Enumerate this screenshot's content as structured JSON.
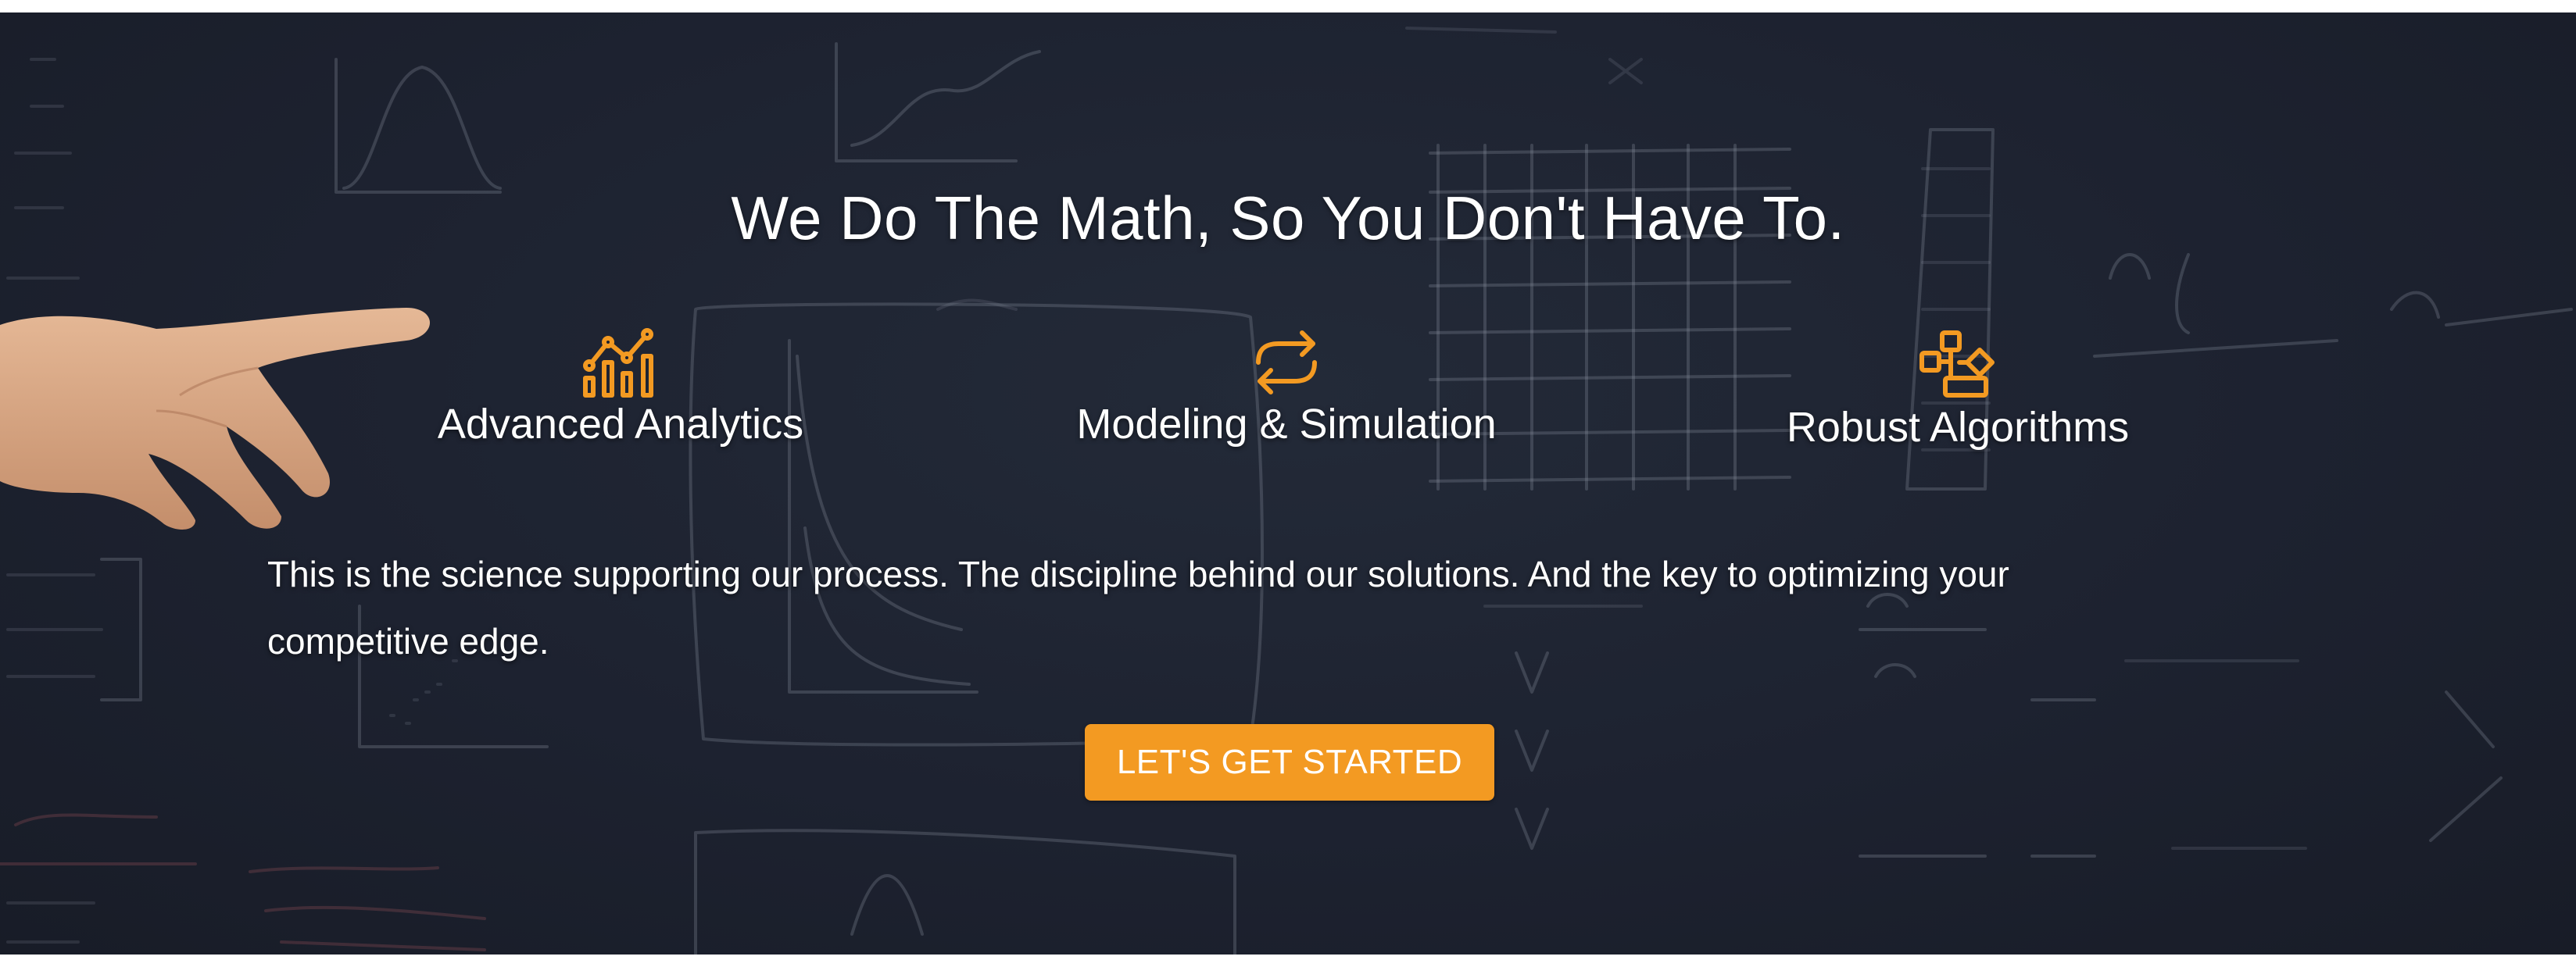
{
  "hero": {
    "headline": "We Do The Math, So You Don't Have To.",
    "features": [
      {
        "label": "Advanced Analytics",
        "icon": "bar-line-chart-icon"
      },
      {
        "label": "Modeling & Simulation",
        "icon": "repeat-cycle-icon"
      },
      {
        "label": "Robust Algorithms",
        "icon": "flowchart-icon"
      }
    ],
    "body": "This is the science supporting our process.  The discipline behind our solutions. And the key to optimizing your competitive edge.",
    "cta_label": "LET'S GET STARTED"
  },
  "colors": {
    "background": "#1d2230",
    "accent": "#f39a22",
    "text": "#ffffff"
  }
}
